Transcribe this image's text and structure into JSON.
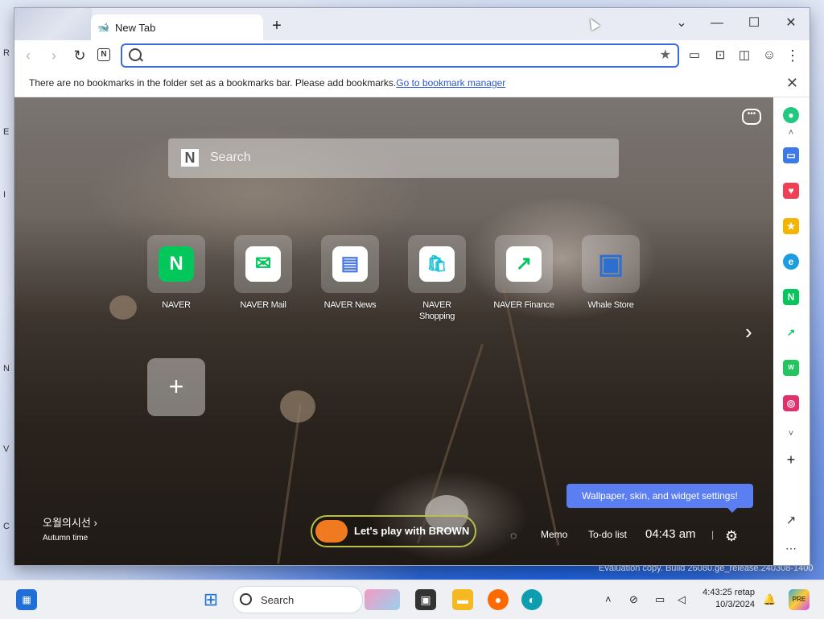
{
  "desktop": {
    "eval_text": "Evaluation copy. Build 26080.ge_release.240308-1400",
    "left_edge_letters": [
      "R",
      "E",
      "I",
      "N",
      "V",
      "C"
    ]
  },
  "browser": {
    "tab_label": "New Tab",
    "window_controls": {
      "dropdown": "⌄",
      "minimize": "—",
      "maximize": "☐",
      "close": "✕"
    }
  },
  "toolbar": {
    "omnibox_value": "",
    "omnibox_placeholder": "",
    "naver_button_label": "N"
  },
  "bookmarks_bar": {
    "message": "There are no bookmarks in the folder set as a bookmarks bar. Please add bookmarks.",
    "link_text": "Go to bookmark manager"
  },
  "newtab": {
    "search_placeholder": "Search",
    "search_logo": "N",
    "shortcuts": [
      {
        "label": "NAVER",
        "icon": "N",
        "color": "#03c75a",
        "fg": "#ffffff"
      },
      {
        "label": "NAVER Mail",
        "icon": "✉",
        "color": "#ffffff",
        "fg": "#03c75a"
      },
      {
        "label": "NAVER News",
        "icon": "▤",
        "color": "#ffffff",
        "fg": "#4a78e8"
      },
      {
        "label": "NAVER Shopping",
        "icon": "🛍",
        "color": "#ffffff",
        "fg": "#19c2d6"
      },
      {
        "label": "NAVER Finance",
        "icon": "↗",
        "color": "#ffffff",
        "fg": "#03c75a"
      },
      {
        "label": "Whale Store",
        "icon": "▣",
        "color": "#2d6fd0",
        "fg": "#0d9e6e"
      }
    ],
    "add_label": "+",
    "widget_title": "오월의시선",
    "widget_subtitle": "Autumn time",
    "brown_label": "Let's play with BROWN",
    "memo_label": "Memo",
    "todo_label": "To-do list",
    "clock": "04:43 am",
    "settings_tooltip": "Wallpaper, skin, and widget settings!"
  },
  "sidebar": {
    "items": [
      {
        "name": "green-circle-app",
        "color": "#1fc980"
      },
      {
        "name": "briefcase-app",
        "color": "#3b7ae8"
      },
      {
        "name": "pocket-app",
        "color": "#ef4056"
      },
      {
        "name": "star-app",
        "color": "#f5b400"
      },
      {
        "name": "edge-app",
        "color": "#1b9de2"
      },
      {
        "name": "naver-shopping-app",
        "color": "#03c75a"
      },
      {
        "name": "naver-finance-app",
        "color": "#03c75a"
      },
      {
        "name": "webtoon-app",
        "color": "#22c55e"
      },
      {
        "name": "instagram-app",
        "color": "#e1306c"
      }
    ]
  },
  "taskbar": {
    "search_label": "Search",
    "clock_time": "4:43:25 retap",
    "clock_date": "10/3/2024"
  }
}
